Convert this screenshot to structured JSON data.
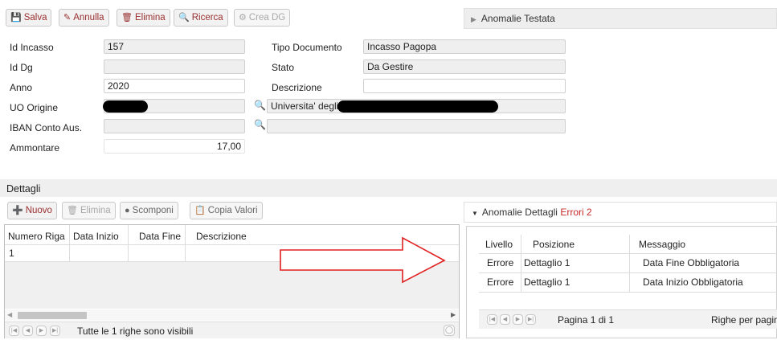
{
  "toolbar": {
    "save": "Salva",
    "cancel": "Annulla",
    "delete": "Elimina",
    "search": "Ricerca",
    "create_dg": "Crea DG"
  },
  "header_panel": {
    "title": "Anomalie Testata"
  },
  "form": {
    "id_incasso": {
      "label": "Id Incasso",
      "value": "157"
    },
    "id_dg": {
      "label": "Id Dg",
      "value": ""
    },
    "anno": {
      "label": "Anno",
      "value": "2020"
    },
    "uo_origine": {
      "label": "UO Origine",
      "value": "",
      "description": "Universita' degli"
    },
    "iban": {
      "label": "IBAN Conto Aus.",
      "value": "",
      "description": ""
    },
    "ammontare": {
      "label": "Ammontare",
      "value": "17,00"
    },
    "tipo_documento": {
      "label": "Tipo Documento",
      "value": "Incasso Pagopa"
    },
    "stato": {
      "label": "Stato",
      "value": "Da Gestire"
    },
    "descrizione": {
      "label": "Descrizione",
      "value": ""
    }
  },
  "details": {
    "title": "Dettagli",
    "toolbar": {
      "new": "Nuovo",
      "delete": "Elimina",
      "split": "Scomponi",
      "copy": "Copia Valori"
    },
    "columns": [
      "Numero Riga",
      "Data Inizio",
      "Data Fine",
      "Descrizione"
    ],
    "rows": [
      {
        "numero": "1",
        "inizio": "",
        "fine": "",
        "descrizione": ""
      }
    ],
    "footer": "Tutte le 1 righe sono visibili"
  },
  "anomalies": {
    "title": "Anomalie Dettagli",
    "errors_label": "Errori",
    "errors_count": "2",
    "columns": [
      "Livello",
      "Posizione",
      "Messaggio"
    ],
    "rows": [
      {
        "livello": "Errore",
        "posizione": "Dettaglio 1",
        "messaggio": "Data Fine Obbligatoria"
      },
      {
        "livello": "Errore",
        "posizione": "Dettaglio 1",
        "messaggio": "Data Inizio Obbligatoria"
      }
    ],
    "pager": "Pagina 1 di 1",
    "rows_per_page": "Righe per pagina"
  },
  "colors": {
    "accent_red": "#9a2f2f",
    "error_red": "#c62828",
    "arrow": "#e02020"
  }
}
